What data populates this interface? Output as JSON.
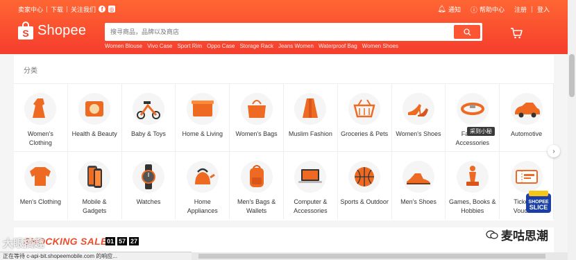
{
  "header": {
    "seller_centre": "卖家中心",
    "download": "下载",
    "follow_us": "关注我们",
    "notifications": "通知",
    "help": "帮助中心",
    "register": "注册",
    "login": "登入",
    "logo_text": "Shopee",
    "search_placeholder": "搜寻商品，品牌以及商店",
    "hot_words": [
      "Women Blouse",
      "Vivo Case",
      "Sport Rim",
      "Oppo Case",
      "Storage Rack",
      "Jeans Women",
      "Waterproof Bag",
      "Women Shoes"
    ]
  },
  "categories_title": "分类",
  "categories": [
    {
      "label": "Women's Clothing",
      "icon": "dress-icon"
    },
    {
      "label": "Health & Beauty",
      "icon": "compact-powder-icon"
    },
    {
      "label": "Baby & Toys",
      "icon": "tricycle-icon"
    },
    {
      "label": "Home & Living",
      "icon": "storage-box-icon"
    },
    {
      "label": "Women's Bags",
      "icon": "handbag-icon"
    },
    {
      "label": "Muslim Fashion",
      "icon": "abaya-icon"
    },
    {
      "label": "Groceries & Pets",
      "icon": "basket-icon"
    },
    {
      "label": "Women's Shoes",
      "icon": "heels-icon"
    },
    {
      "label": "Fashion Accessories",
      "icon": "bracelet-icon"
    },
    {
      "label": "Automotive",
      "icon": "car-icon"
    },
    {
      "label": "Men's Clothing",
      "icon": "sweater-icon"
    },
    {
      "label": "Mobile & Gadgets",
      "icon": "phone-icon"
    },
    {
      "label": "Watches",
      "icon": "watch-icon"
    },
    {
      "label": "Home Appliances",
      "icon": "kettle-icon"
    },
    {
      "label": "Men's Bags & Wallets",
      "icon": "backpack-icon"
    },
    {
      "label": "Computer & Accessories",
      "icon": "laptop-icon"
    },
    {
      "label": "Sports & Outdoor",
      "icon": "basketball-icon"
    },
    {
      "label": "Men's Shoes",
      "icon": "mens-shoe-icon"
    },
    {
      "label": "Games, Books & Hobbies",
      "icon": "chess-icon"
    },
    {
      "label": "Tickets & Vouchers",
      "icon": "ticket-icon"
    }
  ],
  "sale": {
    "title": "SHOCKING SALE",
    "timer": [
      "01",
      "57",
      "27"
    ]
  },
  "overlays": {
    "tooltip": "采到小秘",
    "status": "正在等待 c-api-bit.shopeemobile.com 的响应...",
    "watermark_left": "大眼搞趣",
    "watermark_right": "麦咕思潮",
    "slice_badge": "SHOPEE SLICE"
  },
  "colors": {
    "brand": "#ee4d2d",
    "header_gradient_top": "#ff6633",
    "header_gradient_bottom": "#f53d2d",
    "product_orange": "#ee6a22"
  }
}
